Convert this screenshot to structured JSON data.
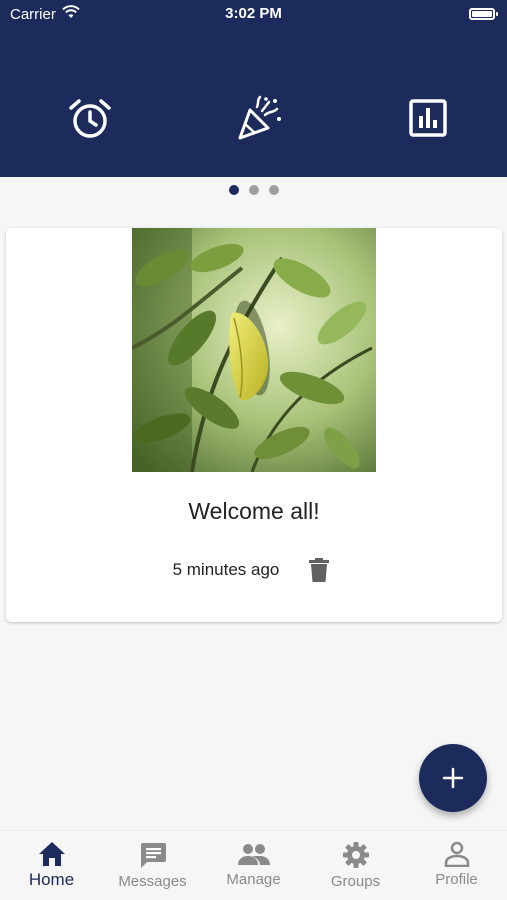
{
  "status_bar": {
    "carrier": "Carrier",
    "time": "3:02 PM"
  },
  "header": {
    "icons": [
      "alarm-clock-icon",
      "party-popper-icon",
      "bar-chart-icon"
    ]
  },
  "pager": {
    "count": 3,
    "active_index": 0
  },
  "post": {
    "title": "Welcome all!",
    "time_ago": "5 minutes ago"
  },
  "fab": {
    "icon": "plus-icon"
  },
  "bottom_nav": {
    "items": [
      {
        "label": "Home",
        "icon": "home-icon",
        "active": true
      },
      {
        "label": "Messages",
        "icon": "message-icon",
        "active": false
      },
      {
        "label": "Manage",
        "icon": "people-icon",
        "active": false
      },
      {
        "label": "Groups",
        "icon": "gear-icon",
        "active": false
      },
      {
        "label": "Profile",
        "icon": "person-icon",
        "active": false
      }
    ]
  },
  "colors": {
    "primary": "#1c2a5c",
    "background": "#f6f6f7",
    "inactive": "#8a8a8a"
  }
}
